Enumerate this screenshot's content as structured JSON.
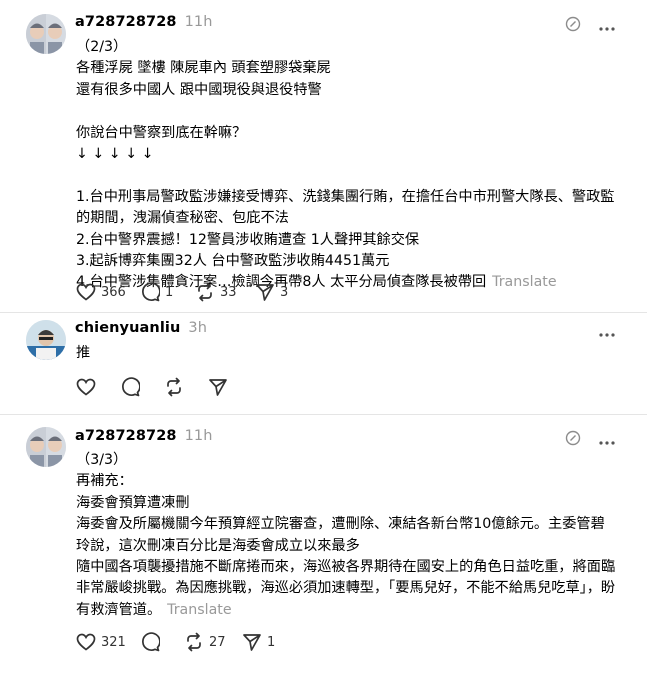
{
  "posts": [
    {
      "username": "a728728728",
      "time": "11h",
      "text": "（2/3）\n各種浮屍 墜樓 陳屍車內 頭套塑膠袋棄屍\n還有很多中國人 跟中國現役與退役特警\n\n你說台中警察到底在幹嘛？\n↓ ↓ ↓ ↓ ↓\n\n1.台中刑事局警政監涉嫌接受博弈、洗錢集團行賄，在擔任台中市刑警大隊長、警政監的期間，洩漏偵查秘密、包庇不法\n2.台中警界震撼！12警員涉收賄遭查 1人聲押其餘交保\n3.起訴博弈集團32人 台中警政監涉收賄4451萬元\n4.台中警涉集體貪汙案…檢調今再帶8人 太平分局偵查隊長被帶回",
      "translate": "Translate",
      "likes": "366",
      "comments": "1",
      "reposts": "33",
      "shares": "3"
    },
    {
      "username": "chienyuanliu",
      "time": "3h",
      "text": "推",
      "likes": "",
      "comments": "",
      "reposts": "",
      "shares": ""
    },
    {
      "username": "a728728728",
      "time": "11h",
      "text": "（3/3）\n再補充：\n海委會預算遭凍刪\n海委會及所屬機關今年預算經立院審查，遭刪除、凍結各新台幣10億餘元。主委管碧玲說，這次刪凍百分比是海委會成立以來最多\n隨中國各項襲擾措施不斷席捲而來，海巡被各界期待在國安上的角色日益吃重，將面臨非常嚴峻挑戰。為因應挑戰，海巡必須加速轉型，「要馬兒好，不能不給馬兒吃草」，盼有救濟管道。",
      "translate": "Translate",
      "likes": "321",
      "comments": "",
      "reposts": "27",
      "shares": "1"
    }
  ],
  "colors": {
    "muted": "#999999",
    "divider": "#e5e5e5",
    "icon": "#333333"
  }
}
